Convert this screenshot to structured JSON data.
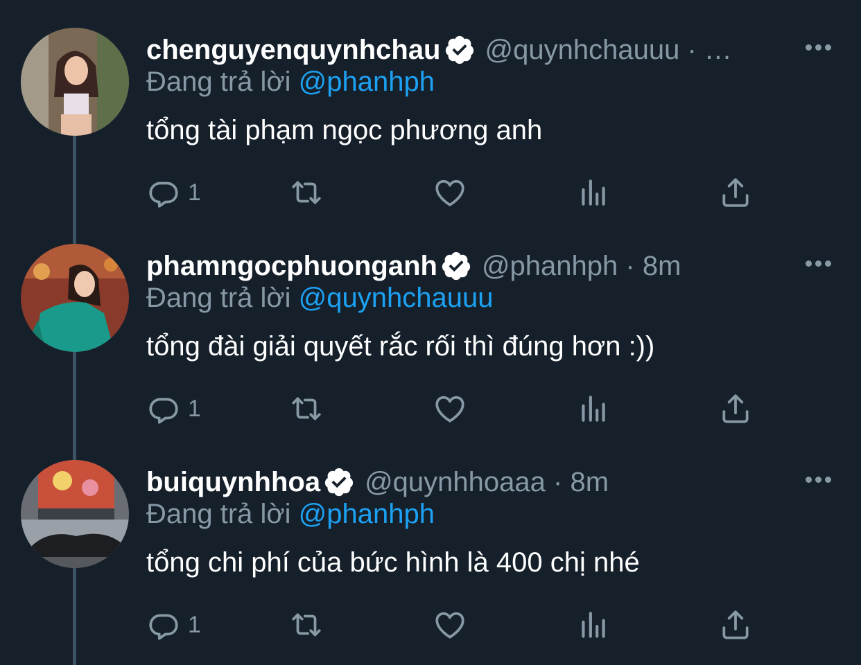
{
  "tweets": [
    {
      "display_name": "chenguyenquynhchau",
      "handle": "@quynhchauuu",
      "time": "…",
      "replying_prefix": "Đang trả lời",
      "replying_to": "@phanhph",
      "text": "tổng tài phạm ngọc phương anh",
      "reply_count": "1"
    },
    {
      "display_name": "phamngocphuonganh",
      "handle": "@phanhph",
      "time": "8m",
      "replying_prefix": "Đang trả lời",
      "replying_to": "@quynhchauuu",
      "text": "tổng đài giải quyết rắc rối thì đúng hơn :))",
      "reply_count": "1"
    },
    {
      "display_name": "buiquynhhoa",
      "handle": "@quynhhoaaa",
      "time": "8m",
      "replying_prefix": "Đang trả lời",
      "replying_to": "@phanhph",
      "text": "tổng chi phí của bức hình là 400 chị nhé",
      "reply_count": "1"
    }
  ],
  "colors": {
    "background": "#15202b",
    "secondary_text": "#8899a6",
    "mention": "#1da1f2",
    "thread_line": "#3d5466"
  },
  "icons": [
    "verified-badge-icon",
    "more-icon",
    "reply-icon",
    "retweet-icon",
    "like-icon",
    "analytics-icon",
    "share-icon"
  ]
}
